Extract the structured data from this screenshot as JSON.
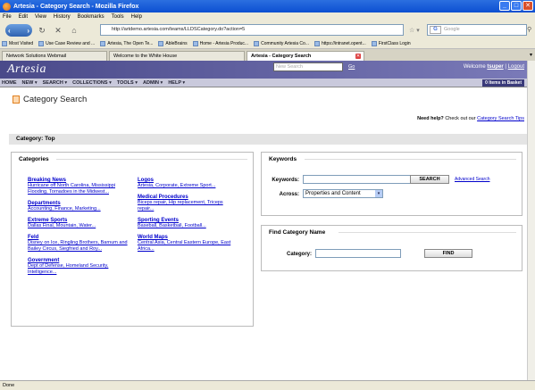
{
  "window": {
    "title": "Artesia - Category Search - Mozilla Firefox",
    "minimize": "_",
    "maximize": "□",
    "close": "✕"
  },
  "menu": [
    "File",
    "Edit",
    "View",
    "History",
    "Bookmarks",
    "Tools",
    "Help"
  ],
  "nav": {
    "url": "http://artdemo.artesia.com/teams/LLDSCategory.do?action=5",
    "search_placeholder": "Google",
    "search_engine_glyph": "G"
  },
  "bookmarks": [
    "Most Visited",
    "Use Case Review and ...",
    "Artesia, The Open Te...",
    "AbleBrains",
    "Home - Artesia Produc...",
    "Community Artesia Co...",
    "https://intranet.opent...",
    "FirstClass Login"
  ],
  "tabs": [
    {
      "label": "Network Solutions Webmail"
    },
    {
      "label": "Welcome to the White House"
    },
    {
      "label": "Artesia - Category Search"
    }
  ],
  "site": {
    "logo": "Artesia",
    "search_placeholder": "New Search",
    "search_go": "Go",
    "welcome_text": "Welcome",
    "username": "tsuper",
    "separator": "|",
    "logout": "Logout",
    "nav": [
      "HOME",
      "NEW ▾",
      "SEARCH ▾",
      "COLLECTIONS ▾",
      "TOOLS ▾",
      "ADMIN ▾",
      "HELP ▾"
    ],
    "basket": "0 Items in Basket"
  },
  "page": {
    "title": "Category Search",
    "help_prefix": "Need help?",
    "help_middle": "Check out our",
    "help_link": "Category Search Tips",
    "category_bar": "Category: Top"
  },
  "categories": {
    "title": "Categories",
    "left": [
      {
        "name": "Breaking News",
        "subs": "Hurricane off North Carolina, Mississippi Flooding, Tornadoes in the Midwest..."
      },
      {
        "name": "Departments",
        "subs": "Accounting, Finance, Marketing..."
      },
      {
        "name": "Extreme Sports",
        "subs": "Dallas Final, Mountain, Water..."
      },
      {
        "name": "Feld",
        "subs": "Disney on Ice, Ringling Brothers, Barnum and Bailey Circus, Siegfried and Roy..."
      },
      {
        "name": "Government",
        "subs": "Dept of Defense, Homeland Security, Intelligence..."
      }
    ],
    "right": [
      {
        "name": "Logos",
        "subs": "Artesia, Corporate, Extreme Sport..."
      },
      {
        "name": "Medical Procedures",
        "subs": "Biceps repair, Hip replacement, Triceps repair..."
      },
      {
        "name": "Sporting Events",
        "subs": "Baseball, Basketball, Football..."
      },
      {
        "name": "World Maps",
        "subs": "Central Asia, Central Eastern Europe, East Africa..."
      }
    ]
  },
  "keywords": {
    "title": "Keywords",
    "keywords_label": "Keywords:",
    "keywords_value": "",
    "search_button": "SEARCH",
    "advanced_link": "Advanced Search",
    "across_label": "Across:",
    "across_value": "Properties and Content"
  },
  "find_category": {
    "title": "Find Category Name",
    "category_label": "Category:",
    "category_value": "",
    "find_button": "FIND"
  },
  "status": "Done",
  "colors": {
    "title_bar": "#0c4fd1",
    "header": "#4a4a8a",
    "link": "#0000cc"
  }
}
